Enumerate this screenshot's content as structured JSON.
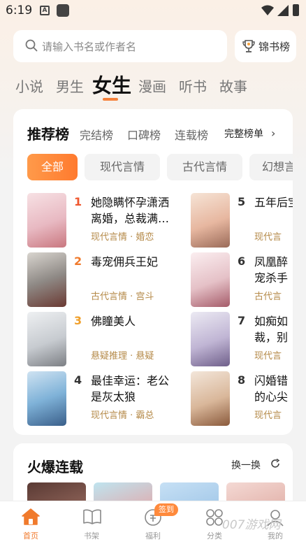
{
  "status_bar": {
    "time": "6:19",
    "a_icon": "A"
  },
  "search": {
    "placeholder": "请输入书名或作者名",
    "rank_label": "锦书榜"
  },
  "channels": [
    "小说",
    "男生",
    "女生",
    "漫画",
    "听书",
    "故事"
  ],
  "active_channel": "女生",
  "recommend": {
    "title": "推荐榜",
    "tabs": [
      "完结榜",
      "口碑榜",
      "连载榜"
    ],
    "full_rank": "完整榜单",
    "chevron": "›",
    "pills": [
      "全部",
      "现代言情",
      "古代言情",
      "幻想言"
    ],
    "books": [
      {
        "rank": "1",
        "title": "她隐瞒怀孕潇洒离婚，总裁满…",
        "tag": "现代言情 · 婚恋"
      },
      {
        "rank": "2",
        "title": "毒宠佣兵王妃",
        "tag": "古代言情 · 宫斗"
      },
      {
        "rank": "3",
        "title": "佛瞳美人",
        "tag": "悬疑推理 · 悬疑"
      },
      {
        "rank": "4",
        "title": "最佳幸运：老公是灰太狼",
        "tag": "现代言情 · 霸总"
      },
      {
        "rank": "5",
        "title": "五年后宝带她",
        "tag": "现代言"
      },
      {
        "rank": "6",
        "title": "凤凰醉宠杀手",
        "tag": "古代言"
      },
      {
        "rank": "7",
        "title": "如痴如裁，别",
        "tag": "现代言"
      },
      {
        "rank": "8",
        "title": "闪婚错的心尖",
        "tag": "现代言"
      }
    ],
    "rank_colors": [
      "#f0572f",
      "#f07a2c",
      "#f0a02c",
      "#333333"
    ]
  },
  "hot": {
    "title": "火爆连载",
    "refresh": "换一换"
  },
  "bottom_nav": {
    "items": [
      "首页",
      "书架",
      "福利",
      "分类",
      "我的"
    ],
    "badge": "签到",
    "accent": "#f07a2c"
  },
  "watermark": "007游戏网"
}
